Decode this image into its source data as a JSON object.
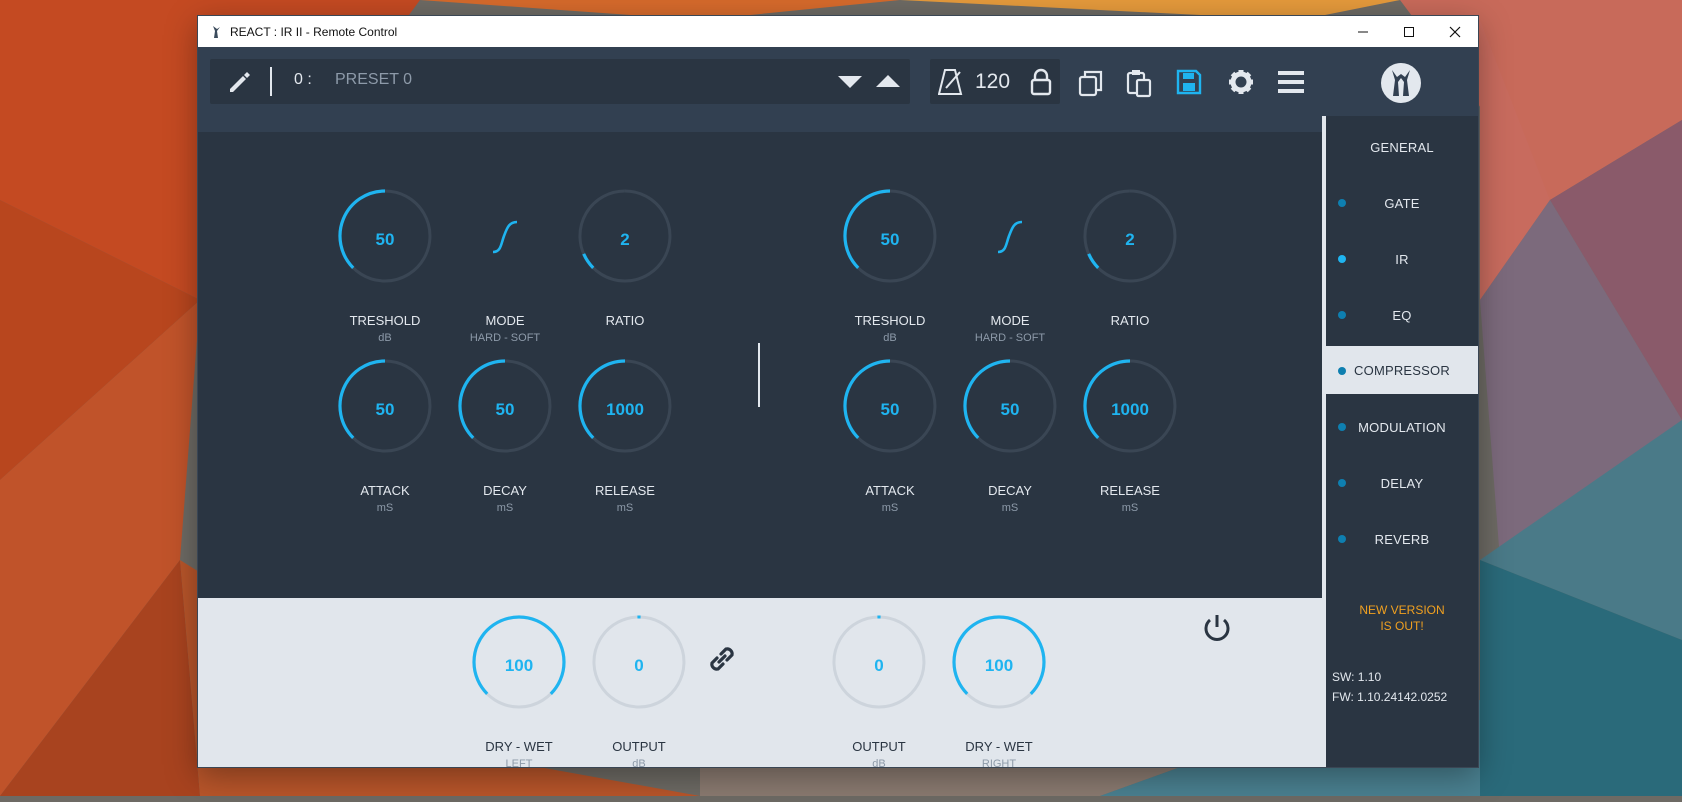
{
  "window": {
    "title": "REACT : IR II - Remote Control"
  },
  "toolbar": {
    "preset_number": "0 :",
    "preset_name": "PRESET 0",
    "tempo": "120"
  },
  "left_channel": {
    "threshold": {
      "value": "50",
      "label": "TRESHOLD",
      "unit": "dB",
      "level": 0.5
    },
    "mode": {
      "label": "MODE",
      "unit": "HARD - SOFT"
    },
    "ratio": {
      "value": "2",
      "label": "RATIO",
      "unit": "",
      "level": 0.08
    },
    "attack": {
      "value": "50",
      "label": "ATTACK",
      "unit": "mS",
      "level": 0.5
    },
    "decay": {
      "value": "50",
      "label": "DECAY",
      "unit": "mS",
      "level": 0.5
    },
    "release": {
      "value": "1000",
      "label": "RELEASE",
      "unit": "mS",
      "level": 0.5
    }
  },
  "right_channel": {
    "threshold": {
      "value": "50",
      "label": "TRESHOLD",
      "unit": "dB",
      "level": 0.5
    },
    "mode": {
      "label": "MODE",
      "unit": "HARD - SOFT"
    },
    "ratio": {
      "value": "2",
      "label": "RATIO",
      "unit": "",
      "level": 0.08
    },
    "attack": {
      "value": "50",
      "label": "ATTACK",
      "unit": "mS",
      "level": 0.5
    },
    "decay": {
      "value": "50",
      "label": "DECAY",
      "unit": "mS",
      "level": 0.5
    },
    "release": {
      "value": "1000",
      "label": "RELEASE",
      "unit": "mS",
      "level": 0.5
    }
  },
  "bottom": {
    "drywet_left": {
      "value": "100",
      "label": "DRY - WET",
      "unit": "LEFT",
      "level": 1.0
    },
    "output_left": {
      "value": "0",
      "label": "OUTPUT",
      "unit": "dB",
      "level": 0.5
    },
    "output_right": {
      "value": "0",
      "label": "OUTPUT",
      "unit": "dB",
      "level": 0.5
    },
    "drywet_right": {
      "value": "100",
      "label": "DRY - WET",
      "unit": "RIGHT",
      "level": 1.0
    }
  },
  "sidebar": {
    "items": [
      {
        "label": "GENERAL"
      },
      {
        "label": "GATE"
      },
      {
        "label": "IR"
      },
      {
        "label": "EQ"
      },
      {
        "label": "COMPRESSOR"
      },
      {
        "label": "MODULATION"
      },
      {
        "label": "DELAY"
      },
      {
        "label": "REVERB"
      }
    ],
    "new_version_line1": "NEW VERSION",
    "new_version_line2": "IS OUT!",
    "sw": "SW: 1.10",
    "fw": "FW: 1.10.24142.0252"
  },
  "colors": {
    "accent": "#1fb4f0",
    "panel": "#2a3542",
    "toolbar": "#324051",
    "light": "#e1e6ec",
    "warning": "#f0a020"
  }
}
